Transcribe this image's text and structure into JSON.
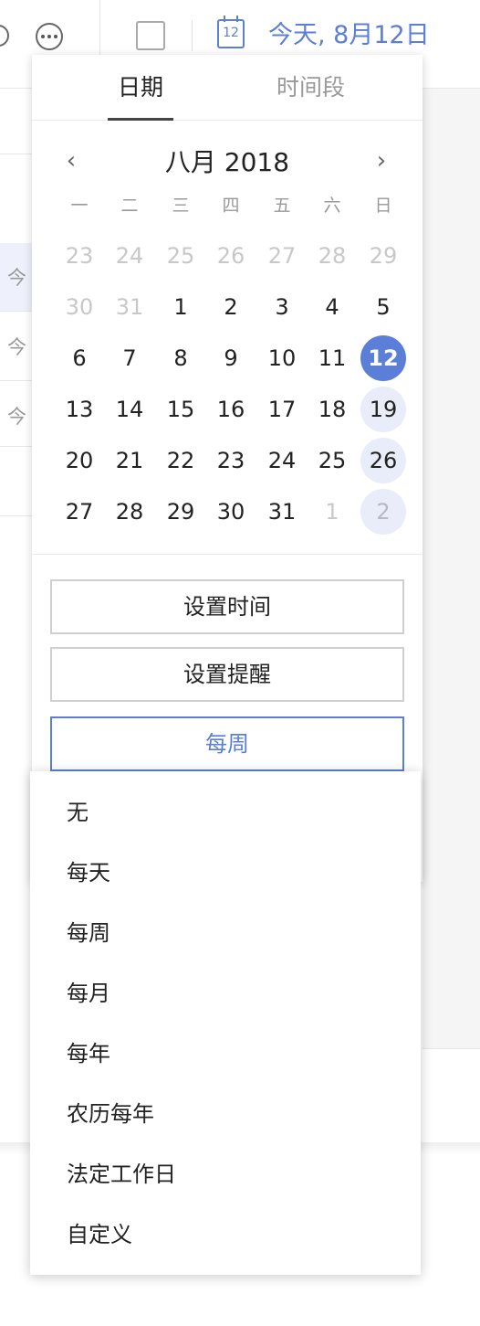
{
  "toolbar": {
    "date_icon_day": "12",
    "date_label": "今天, 8月12日"
  },
  "task_list": {
    "rows": [
      "今",
      "今",
      "今"
    ]
  },
  "picker": {
    "tabs": {
      "date": "日期",
      "range": "时间段"
    },
    "month_title": "八月 2018",
    "prev_glyph": "‹",
    "next_glyph": "›",
    "weekdays": [
      "一",
      "二",
      "三",
      "四",
      "五",
      "六",
      "日"
    ],
    "weeks": [
      [
        "23",
        "24",
        "25",
        "26",
        "27",
        "28",
        "29"
      ],
      [
        "30",
        "31",
        "1",
        "2",
        "3",
        "4",
        "5"
      ],
      [
        "6",
        "7",
        "8",
        "9",
        "10",
        "11",
        "12"
      ],
      [
        "13",
        "14",
        "15",
        "16",
        "17",
        "18",
        "19"
      ],
      [
        "20",
        "21",
        "22",
        "23",
        "24",
        "25",
        "26"
      ],
      [
        "27",
        "28",
        "29",
        "30",
        "31",
        "1",
        "2"
      ]
    ],
    "selected_day": "12",
    "buttons": {
      "set_time": "设置时间",
      "set_reminder": "设置提醒",
      "repeat": "每周"
    }
  },
  "repeat_menu": {
    "items": [
      "无",
      "每天",
      "每周",
      "每月",
      "每年",
      "农历每年",
      "法定工作日",
      "自定义"
    ]
  },
  "colors": {
    "accent": "#5b7fd6",
    "highlight": "#e9ecf9"
  },
  "icons": [
    "more-icon",
    "calendar-icon",
    "chevron-left-icon",
    "chevron-right-icon"
  ]
}
